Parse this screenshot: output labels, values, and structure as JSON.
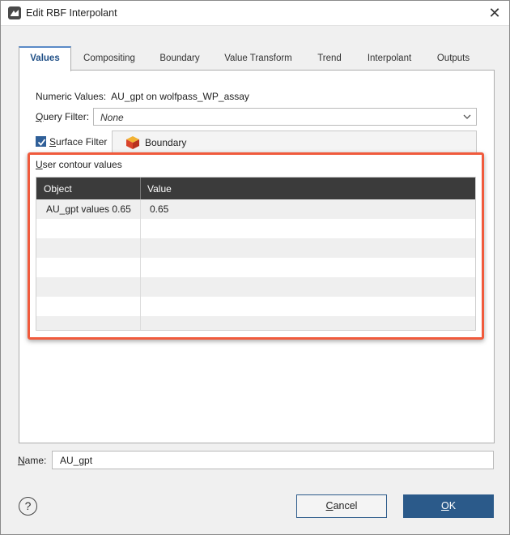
{
  "window": {
    "title": "Edit RBF Interpolant",
    "app_icon": "leapfrog-icon",
    "close_icon": "close-icon"
  },
  "tabs": [
    {
      "label": "Values",
      "active": true
    },
    {
      "label": "Compositing",
      "active": false
    },
    {
      "label": "Boundary",
      "active": false
    },
    {
      "label": "Value Transform",
      "active": false
    },
    {
      "label": "Trend",
      "active": false
    },
    {
      "label": "Interpolant",
      "active": false
    },
    {
      "label": "Outputs",
      "active": false
    }
  ],
  "values_tab": {
    "numeric_values_label": "Numeric Values:",
    "numeric_values_value": "AU_gpt on wolfpass_WP_assay",
    "query_filter_label_underline": "Q",
    "query_filter_label_rest": "uery Filter:",
    "query_filter_value": "None",
    "surface_filter_checked": true,
    "surface_filter_label_underline": "S",
    "surface_filter_label_rest": "urface Filter",
    "surface_filter_value": "Boundary",
    "user_contour_label_underline": "U",
    "user_contour_label_rest": "ser contour values",
    "grid": {
      "columns": [
        "Object",
        "Value"
      ],
      "rows": [
        {
          "object": "AU_gpt values 0.65",
          "value": "0.65"
        }
      ]
    }
  },
  "name_field": {
    "label_underline": "N",
    "label_rest": "ame:",
    "value": "AU_gpt"
  },
  "footer": {
    "help_label": "?",
    "cancel_underline": "C",
    "cancel_rest": "ancel",
    "ok_underline": "O",
    "ok_rest": "K"
  },
  "colors": {
    "accent": "#2b5a8a",
    "highlight": "#f05a3c",
    "grid_header": "#3b3b3b"
  }
}
